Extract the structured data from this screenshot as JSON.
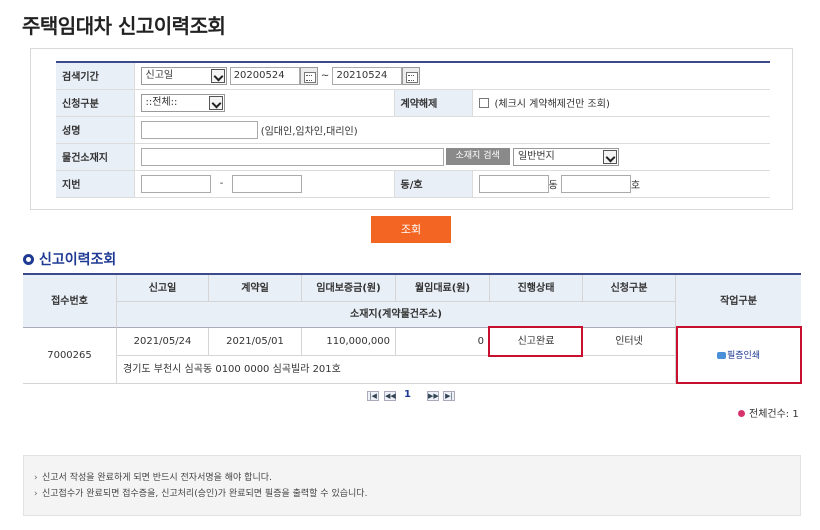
{
  "page_title": "주택임대차 신고이력조회",
  "search": {
    "period_label": "검색기간",
    "period_type": "신고일",
    "date_from": "20200524",
    "date_sep": "~",
    "date_to": "20210524",
    "apply_type_label": "신청구분",
    "apply_type_value": "::전체::",
    "cancel_label": "계약해제",
    "cancel_hint": "(체크시 계약해제건만 조회)",
    "name_label": "성명",
    "name_value": "",
    "name_hint": "(임대인,임차인,대리인)",
    "address_label": "물건소재지",
    "address_value": "",
    "address_button": "소재지 검색",
    "lot_type": "일반번지",
    "lot_label": "지번",
    "lot_main": "",
    "lot_dash": "-",
    "lot_sub": "",
    "dong_label": "동/호",
    "dong_value": "",
    "dong_unit": "동",
    "ho_value": "",
    "ho_unit": "호",
    "search_button": "조회"
  },
  "results": {
    "section_title": "신고이력조회",
    "headers": {
      "receipt_no": "접수번호",
      "report_date": "신고일",
      "contract_date": "계약일",
      "deposit": "임대보증금(원)",
      "monthly_rent": "월임대료(원)",
      "status": "진행상태",
      "apply_type": "신청구분",
      "action": "작업구분",
      "location": "소재지(계약물건주소)"
    },
    "rows": [
      {
        "receipt_no": "7000265",
        "report_date": "2021/05/24",
        "contract_date": "2021/05/01",
        "deposit": "110,000,000",
        "monthly_rent": "0",
        "status": "신고완료",
        "apply_type": "인터넷",
        "action": "필증인쇄",
        "address": "경기도 부천시 심곡동 0100 0000 심곡빌라 201호"
      }
    ],
    "pagination": {
      "current_page": "1"
    },
    "total_label": "전체건수: 1"
  },
  "notices": [
    "신고서 작성을 완료하게 되면 반드시 전자서명을 해야 합니다.",
    "신고접수가 완료되면 접수증을, 신고처리(승인)가 완료되면 필증을 출력할 수 있습니다."
  ],
  "colors": {
    "accent": "#1f3a93",
    "search_button": "#f26522",
    "highlight": "#c8102e",
    "header_bg": "#e9eff7"
  }
}
